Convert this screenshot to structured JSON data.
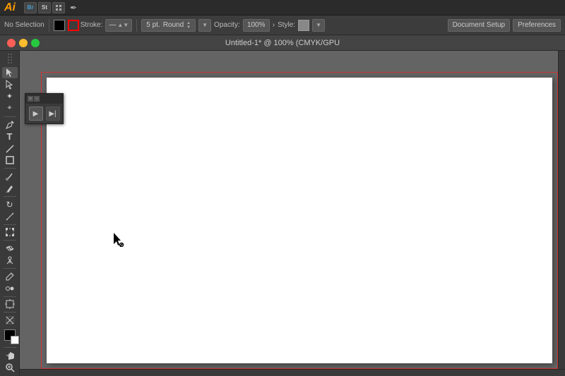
{
  "app": {
    "logo": "Ai",
    "logo_color": "#ff9a00"
  },
  "menu_bar": {
    "icons": [
      "Ai",
      "Br",
      "St",
      "grid",
      "pen"
    ]
  },
  "options_bar": {
    "selection_label": "No Selection",
    "stroke_label": "Stroke:",
    "brush_size": "5 pt.",
    "brush_type": "Round",
    "opacity_label": "Opacity:",
    "opacity_value": "100%",
    "opacity_arrow": "›",
    "style_label": "Style:",
    "doc_setup_label": "Document Setup",
    "preferences_label": "Preferences"
  },
  "title_bar": {
    "title": "Untitled-1* @ 100% (CMYK/GPU"
  },
  "mini_panel": {
    "close_btn": "×",
    "collapse_btn": "−",
    "tool1_symbol": "▶",
    "tool2_symbol": "▶|"
  },
  "tools": [
    {
      "name": "selection",
      "symbol": "↖"
    },
    {
      "name": "direct-selection",
      "symbol": "↗"
    },
    {
      "name": "magic-wand",
      "symbol": "✦"
    },
    {
      "name": "lasso",
      "symbol": "⌖"
    },
    {
      "name": "pen",
      "symbol": "✒"
    },
    {
      "name": "type",
      "symbol": "T"
    },
    {
      "name": "line",
      "symbol": "/"
    },
    {
      "name": "rectangle",
      "symbol": "□"
    },
    {
      "name": "paintbrush",
      "symbol": "🖌"
    },
    {
      "name": "pencil",
      "symbol": "✏"
    },
    {
      "name": "rotate",
      "symbol": "↻"
    },
    {
      "name": "reflect",
      "symbol": "⇄"
    },
    {
      "name": "scale",
      "symbol": "⤢"
    },
    {
      "name": "warp",
      "symbol": "~"
    },
    {
      "name": "free-transform",
      "symbol": "⊡"
    },
    {
      "name": "puppet-warp",
      "symbol": "※"
    },
    {
      "name": "eyedropper",
      "symbol": "💧"
    },
    {
      "name": "blend",
      "symbol": "◈"
    },
    {
      "name": "artboard",
      "symbol": "⊞"
    },
    {
      "name": "slice",
      "symbol": "✂"
    },
    {
      "name": "hand",
      "symbol": "✋"
    },
    {
      "name": "zoom",
      "symbol": "🔍"
    }
  ]
}
